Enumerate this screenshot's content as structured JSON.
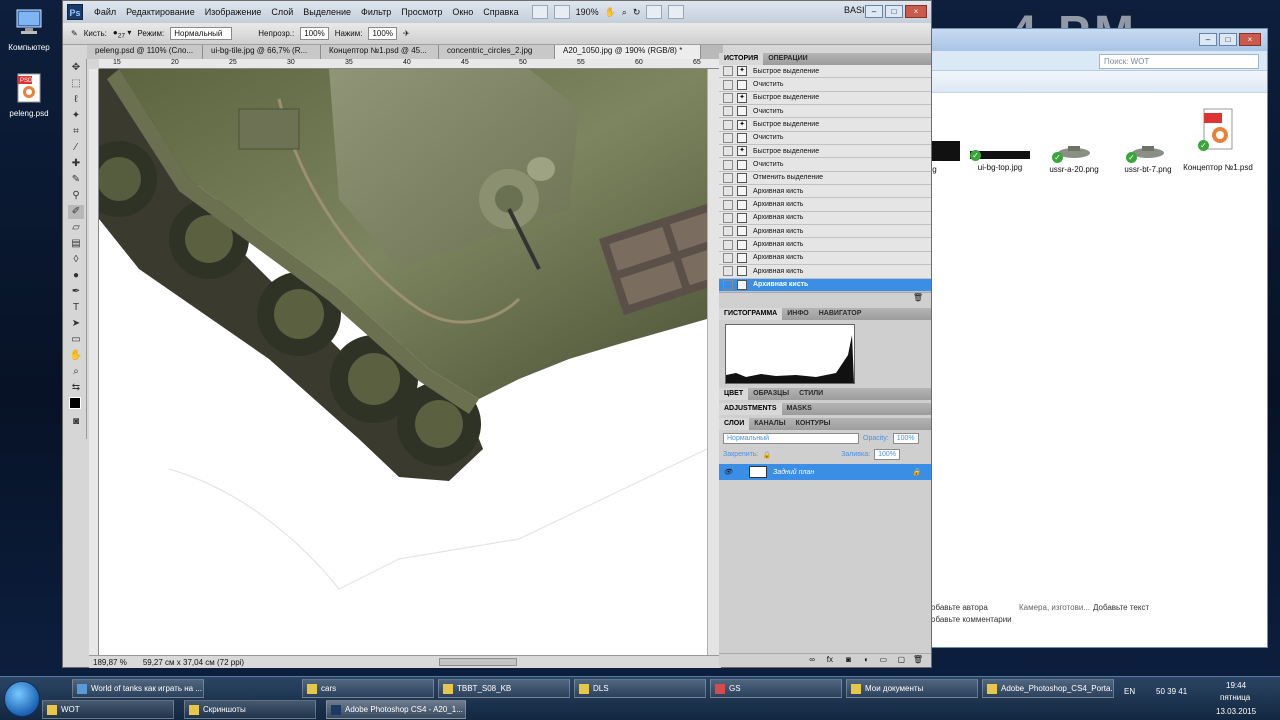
{
  "desktop": {
    "icons": [
      {
        "label": "Компьютер"
      },
      {
        "label": "peleng.psd"
      }
    ],
    "clock_overlay": "4 PM"
  },
  "explorer": {
    "search_placeholder": "Поиск: WOT",
    "files": [
      {
        "name": "e.jpg"
      },
      {
        "name": "ui-bg-top.jpg"
      },
      {
        "name": "ussr-a-20.png"
      },
      {
        "name": "ussr-bt-7.png"
      },
      {
        "name": "Концептор №1.psd"
      }
    ],
    "details": {
      "author": "обавьте автора",
      "camera": "Камера, изготови...",
      "text": "Добавьте текст",
      "comments": "обавьте комментарии"
    }
  },
  "photoshop": {
    "menus": [
      "Файл",
      "Редактирование",
      "Изображение",
      "Слой",
      "Выделение",
      "Фильтр",
      "Просмотр",
      "Окно",
      "Справка"
    ],
    "zoom_dropdown": "190%",
    "workspace": "BASIC",
    "options": {
      "brush_label": "Кисть:",
      "brush_size": "27",
      "mode_label": "Режим:",
      "mode_value": "Нормальный",
      "opacity_label": "Непрозр.:",
      "opacity_value": "100%",
      "flow_label": "Нажим:",
      "flow_value": "100%"
    },
    "tabs": [
      {
        "label": "peleng.psd @ 110% (Сло..."
      },
      {
        "label": "ui-bg-tile.jpg @ 66,7% (R..."
      },
      {
        "label": "Концептор №1.psd @ 45..."
      },
      {
        "label": "concentric_circles_2.jpg"
      },
      {
        "label": "A20_1050.jpg @ 190% (RGB/8) *"
      }
    ],
    "ruler_ticks": [
      "15",
      "20",
      "25",
      "30",
      "35",
      "40",
      "45",
      "50",
      "55",
      "60",
      "65"
    ],
    "status": {
      "zoom": "189,87 %",
      "doc_size": "59,27 см x 37,04 см (72 ppi)"
    },
    "history_panel": {
      "tabs": [
        "ИСТОРИЯ",
        "ОПЕРАЦИИ"
      ],
      "items": [
        {
          "label": "Быстрое выделение"
        },
        {
          "label": "Очистить"
        },
        {
          "label": "Быстрое выделение"
        },
        {
          "label": "Очистить"
        },
        {
          "label": "Быстрое выделение"
        },
        {
          "label": "Очистить"
        },
        {
          "label": "Быстрое выделение"
        },
        {
          "label": "Очистить"
        },
        {
          "label": "Отменить выделение"
        },
        {
          "label": "Архивная кисть"
        },
        {
          "label": "Архивная кисть"
        },
        {
          "label": "Архивная кисть"
        },
        {
          "label": "Архивная кисть"
        },
        {
          "label": "Архивная кисть"
        },
        {
          "label": "Архивная кисть"
        },
        {
          "label": "Архивная кисть"
        },
        {
          "label": "Архивная кисть"
        }
      ]
    },
    "histogram_panel": {
      "tabs": [
        "ГИСТОГРАММА",
        "ИНФО",
        "НАВИГАТОР"
      ]
    },
    "color_panel": {
      "tabs": [
        "ЦВЕТ",
        "ОБРАЗЦЫ",
        "СТИЛИ"
      ]
    },
    "adjustments_panel": {
      "tabs": [
        "ADJUSTMENTS",
        "MASKS"
      ]
    },
    "layers_panel": {
      "tabs": [
        "СЛОИ",
        "КАНАЛЫ",
        "КОНТУРЫ"
      ],
      "blend_mode": "Нормальный",
      "opacity_label": "Opacity:",
      "opacity_value": "100%",
      "lock_label": "Закрепить:",
      "fill_label": "Заливка:",
      "fill_value": "100%",
      "layers": [
        {
          "name": "Задний план"
        }
      ]
    }
  },
  "taskbar": {
    "row1": [
      {
        "label": "World of tanks как играть на ..."
      },
      {
        "label": "cars"
      },
      {
        "label": "TBBT_S08_KB"
      },
      {
        "label": "DLS"
      },
      {
        "label": "GS"
      },
      {
        "label": "Мои документы"
      },
      {
        "label": "Adobe_Photoshop_CS4_Porta..."
      }
    ],
    "row2": [
      {
        "label": "WOT"
      },
      {
        "label": "Скриншоты"
      },
      {
        "label": "Adobe Photoshop CS4 - A20_1..."
      }
    ],
    "tray": {
      "lang": "EN",
      "nums": "50  39  41",
      "time": "19:44",
      "weekday": "пятница",
      "date": "13.03.2015"
    }
  }
}
